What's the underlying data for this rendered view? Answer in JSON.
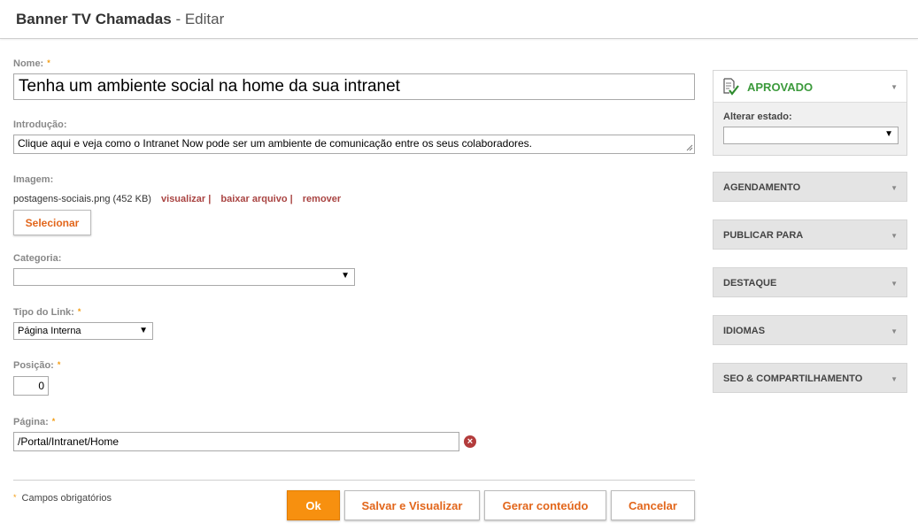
{
  "header": {
    "title": "Banner TV Chamadas",
    "separator": " - ",
    "subtitle": "Editar"
  },
  "form": {
    "required_marker": "*",
    "name": {
      "label": "Nome:",
      "value": "Tenha um ambiente social na home da sua intranet"
    },
    "intro": {
      "label": "Introdução:",
      "value": "Clique aqui e veja como o Intranet Now pode ser um ambiente de comunicação entre os seus colaboradores."
    },
    "image": {
      "label": "Imagem:",
      "file_name": "postagens-sociais.png",
      "file_size": "(452 KB)",
      "view_link": "visualizar",
      "download_link": "baixar arquivo",
      "remove_link": "remover",
      "link_separator": "|",
      "select_button": "Selecionar"
    },
    "category": {
      "label": "Categoria:",
      "value": ""
    },
    "link_type": {
      "label": "Tipo do Link:",
      "value": "Página Interna"
    },
    "position": {
      "label": "Posição:",
      "value": "0"
    },
    "page": {
      "label": "Página:",
      "value": "/Portal/Intranet/Home"
    },
    "required_note": "Campos obrigatórios"
  },
  "actions": {
    "ok": "Ok",
    "save_view": "Salvar e Visualizar",
    "generate": "Gerar conteúdo",
    "cancel": "Cancelar"
  },
  "sidebar": {
    "status": {
      "text": "APROVADO",
      "change_label": "Alterar estado:",
      "change_value": ""
    },
    "panels": [
      {
        "label": "AGENDAMENTO"
      },
      {
        "label": "PUBLICAR PARA"
      },
      {
        "label": "DESTAQUE"
      },
      {
        "label": "IDIOMAS"
      },
      {
        "label": "SEO & COMPARTILHAMENTO"
      }
    ]
  },
  "icons": {
    "approved": "document-check-icon",
    "dropdown": "chevron-down-icon",
    "clear": "clear-icon"
  },
  "colors": {
    "accent": "#e2661b",
    "primary_button": "#f7900f",
    "approved": "#3c9a3c",
    "link": "#a94442",
    "required": "#f39c12"
  }
}
